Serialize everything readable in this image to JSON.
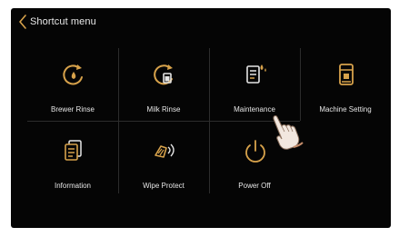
{
  "header": {
    "title": "Shortcut menu"
  },
  "tiles": [
    {
      "label": "Brewer Rinse",
      "icon": "brewer-rinse-icon"
    },
    {
      "label": "Milk Rinse",
      "icon": "milk-rinse-icon"
    },
    {
      "label": "Maintenance",
      "icon": "maintenance-icon"
    },
    {
      "label": "Machine Setting",
      "icon": "machine-setting-icon"
    },
    {
      "label": "Information",
      "icon": "information-icon"
    },
    {
      "label": "Wipe Protect",
      "icon": "wipe-protect-icon"
    },
    {
      "label": "Power Off",
      "icon": "power-off-icon"
    }
  ],
  "colors": {
    "accent": "#d7a24b",
    "background": "#050505",
    "text": "#e6e6e6"
  }
}
